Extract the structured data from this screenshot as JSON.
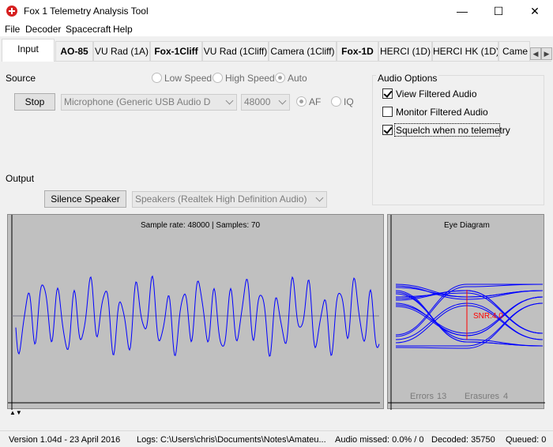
{
  "window": {
    "title": "Fox 1 Telemetry Analysis Tool",
    "minimize": "—",
    "maximize": "☐",
    "close": "✕"
  },
  "menu": [
    "File",
    "Decoder",
    "Spacecraft",
    "Help"
  ],
  "tabs": [
    {
      "label": "Input",
      "bold": false,
      "active": true
    },
    {
      "label": "AO-85",
      "bold": true
    },
    {
      "label": "VU Rad (1A)",
      "bold": false
    },
    {
      "label": "Fox-1Cliff",
      "bold": true
    },
    {
      "label": "VU Rad (1Cliff)",
      "bold": false
    },
    {
      "label": "Camera (1Cliff)",
      "bold": false
    },
    {
      "label": "Fox-1D",
      "bold": true
    },
    {
      "label": "HERCI (1D)",
      "bold": false
    },
    {
      "label": "HERCI HK (1D)",
      "bold": false
    },
    {
      "label": "Came",
      "bold": false
    }
  ],
  "tab_scroll": {
    "left": "◀",
    "right": "▶"
  },
  "source": {
    "label": "Source",
    "speed_options": [
      {
        "label": "Low Speed",
        "checked": false
      },
      {
        "label": "High Speed",
        "checked": false
      },
      {
        "label": "Auto",
        "checked": true
      }
    ],
    "stop_button": "Stop",
    "device": "Microphone (Generic USB Audio D",
    "sample_rate": "48000",
    "mode_options": [
      {
        "label": "AF",
        "checked": true
      },
      {
        "label": "IQ",
        "checked": false
      }
    ]
  },
  "audio_options": {
    "title": "Audio Options",
    "items": [
      {
        "label": "View Filtered Audio",
        "checked": true
      },
      {
        "label": "Monitor Filtered Audio",
        "checked": false
      },
      {
        "label": "Squelch when no telemetry",
        "checked": true
      }
    ]
  },
  "output": {
    "label": "Output",
    "silence_button": "Silence Speaker",
    "device": "Speakers (Realtek High Definition Audio)"
  },
  "scope": {
    "caption": "Sample rate: 48000 | Samples: 70",
    "trace_color": "#0000ff"
  },
  "eye": {
    "title": "Eye Diagram",
    "snr": "SNR:4.0",
    "errors_label": "Errors",
    "errors_value": "13",
    "erasures_label": "Erasures",
    "erasures_value": "4",
    "snr_color": "#ff0000"
  },
  "status": {
    "version": "Version 1.04d - 23 April 2016",
    "logs": "Logs: C:\\Users\\chris\\Documents\\Notes\\Amateu...",
    "audio_missed": "Audio missed: 0.0% / 0",
    "decoded": "Decoded: 35750",
    "queued": "Queued: 0"
  }
}
